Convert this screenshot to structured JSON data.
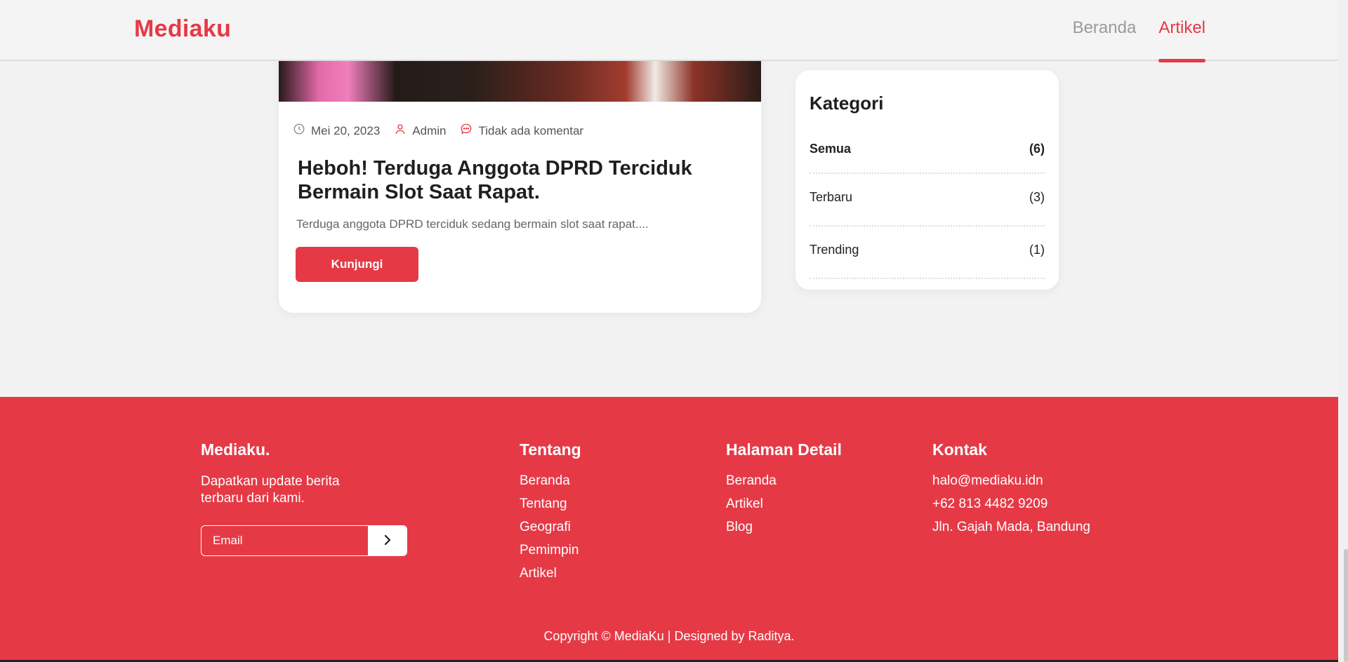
{
  "header": {
    "brand": "Mediaku",
    "nav": [
      {
        "label": "Beranda"
      },
      {
        "label": "Artikel"
      }
    ]
  },
  "article": {
    "date": "Mei 20, 2023",
    "author": "Admin",
    "comments": "Tidak ada komentar",
    "title": "Heboh! Terduga Anggota DPRD Terciduk Bermain Slot Saat Rapat.",
    "excerpt": "Terduga anggota DPRD terciduk sedang bermain slot saat rapat....",
    "button": "Kunjungi"
  },
  "sidebar": {
    "title": "Kategori",
    "categories": [
      {
        "name": "Semua",
        "count": "(6)"
      },
      {
        "name": "Terbaru",
        "count": "(3)"
      },
      {
        "name": "Trending",
        "count": "(1)"
      }
    ]
  },
  "footer": {
    "brand": "Mediaku.",
    "description": "Dapatkan update berita terbaru dari kami.",
    "email_placeholder": "Email",
    "tentang": {
      "title": "Tentang",
      "links": [
        "Beranda",
        "Tentang",
        "Geografi",
        "Pemimpin",
        "Artikel"
      ]
    },
    "halaman": {
      "title": "Halaman Detail",
      "links": [
        "Beranda",
        "Artikel",
        "Blog"
      ]
    },
    "kontak": {
      "title": "Kontak",
      "items": [
        "halo@mediaku.idn",
        "+62 813 4482 9209",
        "Jln. Gajah Mada, Bandung"
      ]
    },
    "copyright": "Copyright © MediaKu | Designed by Raditya."
  },
  "colors": {
    "accent": "#e63946",
    "background": "#f2f2f2"
  }
}
